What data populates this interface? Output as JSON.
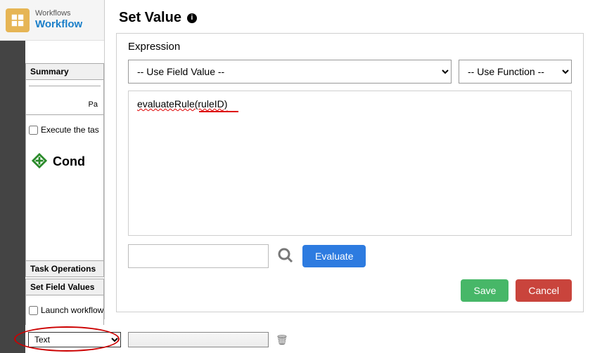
{
  "header": {
    "super": "Workflows",
    "title": "Workflow"
  },
  "modal": {
    "title": "Set Value",
    "expression_label": "Expression",
    "field_dropdown_label": "-- Use Field Value --",
    "function_dropdown_label": "-- Use Function --",
    "expression_text": "evaluateRule(ruleID)",
    "evaluate_label": "Evaluate",
    "save_label": "Save",
    "cancel_label": "Cancel"
  },
  "side": {
    "summary_label": "Summary",
    "pa_label": "Pa",
    "execute_label": "Execute the tas",
    "cond_label": "Cond",
    "task_ops_label": "Task Operations",
    "set_field_label": "Set Field Values",
    "launch_label": "Launch workflow"
  },
  "bottom": {
    "type_value": "Text",
    "input_value": ""
  }
}
